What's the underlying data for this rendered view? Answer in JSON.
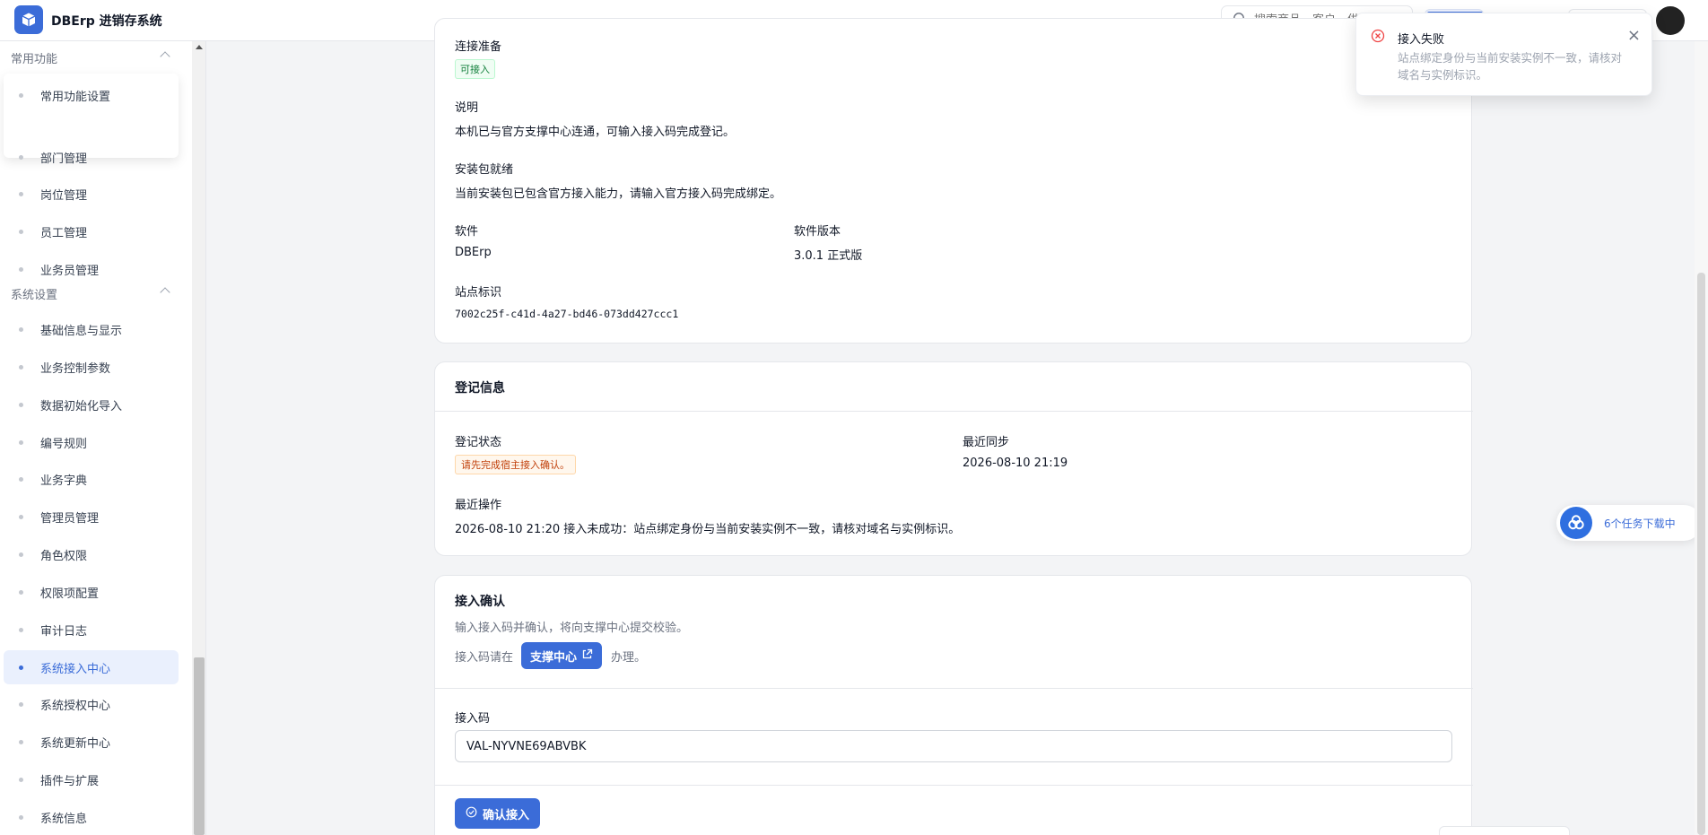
{
  "app": {
    "title": "DBErp 进销存系统"
  },
  "header": {
    "search_placeholder": "搜索商品、客户、供"
  },
  "sidebar": {
    "group_common": "常用功能",
    "common_items": [
      {
        "label": "常用功能设置"
      }
    ],
    "org_items": [
      {
        "label": "部门管理"
      },
      {
        "label": "岗位管理"
      },
      {
        "label": "员工管理"
      },
      {
        "label": "业务员管理"
      }
    ],
    "group_system": "系统设置",
    "system_items": [
      {
        "label": "基础信息与显示"
      },
      {
        "label": "业务控制参数"
      },
      {
        "label": "数据初始化导入"
      },
      {
        "label": "编号规则"
      },
      {
        "label": "业务字典"
      },
      {
        "label": "管理员管理"
      },
      {
        "label": "角色权限"
      },
      {
        "label": "权限项配置"
      },
      {
        "label": "审计日志"
      },
      {
        "label": "系统接入中心",
        "active": true
      },
      {
        "label": "系统授权中心"
      },
      {
        "label": "系统更新中心"
      },
      {
        "label": "插件与扩展"
      },
      {
        "label": "系统信息"
      }
    ]
  },
  "env_card": {
    "conn_label": "连接准备",
    "conn_tag": "可接入",
    "desc_label": "说明",
    "desc_value": "本机已与官方支撑中心连通，可输入接入码完成登记。",
    "pkg_label": "安装包就绪",
    "pkg_value": "当前安装包已包含官方接入能力，请输入官方接入码完成绑定。",
    "software_label": "软件",
    "software_value": "DBErp",
    "version_label": "软件版本",
    "version_value": "3.0.1 正式版",
    "site_label": "站点标识",
    "site_value": "7002c25f-c41d-4a27-bd46-073dd427ccc1"
  },
  "registration": {
    "title": "登记信息",
    "status_label": "登记状态",
    "status_tag": "请先完成宿主接入确认。",
    "sync_label": "最近同步",
    "sync_value": "2026-08-10 21:19",
    "op_label": "最近操作",
    "op_value": "2026-08-10 21:20 接入未成功：站点绑定身份与当前安装实例不一致，请核对域名与实例标识。"
  },
  "access": {
    "title": "接入确认",
    "desc": "输入接入码并确认，将向支撑中心提交校验。",
    "where_prefix": "接入码请在",
    "support_btn": "支撑中心",
    "where_suffix": "办理。",
    "code_label": "接入码",
    "code_value": "VAL-NYVNE69ABVBK",
    "confirm_btn": "确认接入"
  },
  "toast": {
    "title": "接入失败",
    "message": "站点绑定身份与当前安装实例不一致，请核对域名与实例标识。"
  },
  "download": {
    "text": "6个任务下载中"
  },
  "colors": {
    "accent": "#3b6cd8",
    "success": "#15803d",
    "warning": "#c2410c",
    "error": "#ef4444"
  }
}
